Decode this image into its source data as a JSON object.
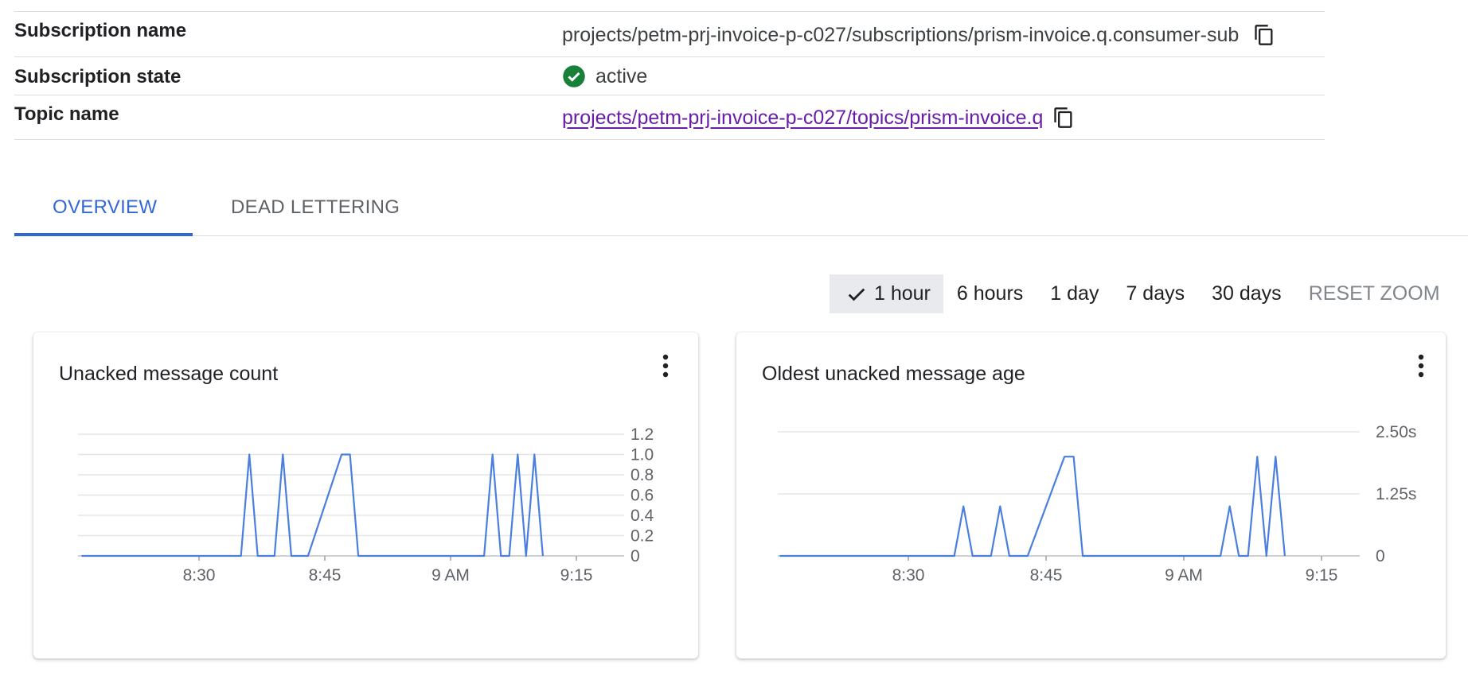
{
  "properties": {
    "subscription_name": {
      "label": "Subscription name",
      "value": "projects/petm-prj-invoice-p-c027/subscriptions/prism-invoice.q.consumer-sub"
    },
    "subscription_state": {
      "label": "Subscription state",
      "value": "active",
      "status_icon": "check-circle-icon",
      "status_color": "#188038"
    },
    "topic_name": {
      "label": "Topic name",
      "value": "projects/petm-prj-invoice-p-c027/topics/prism-invoice.q",
      "link_color": "#681da8"
    }
  },
  "tabs": [
    {
      "label": "OVERVIEW",
      "active": true
    },
    {
      "label": "DEAD LETTERING",
      "active": false
    }
  ],
  "time_range": {
    "options": [
      "1 hour",
      "6 hours",
      "1 day",
      "7 days",
      "30 days"
    ],
    "selected": "1 hour",
    "reset_label": "RESET ZOOM"
  },
  "accent_color": "#3367d6",
  "chart_data": [
    {
      "type": "line",
      "title": "Unacked message count",
      "series_color": "#4a7fe0",
      "x_tick_labels": [
        "8:30",
        "8:45",
        "9 AM",
        "9:15"
      ],
      "y_tick_labels": [
        "1.2",
        "1.0",
        "0.8",
        "0.6",
        "0.4",
        "0.2",
        "0"
      ],
      "ylim": [
        0,
        1.2
      ],
      "grid": true,
      "series": [
        {
          "x": [
            "8:16",
            "8:35",
            "8:36",
            "8:37",
            "8:39",
            "8:40",
            "8:41",
            "8:43",
            "8:47",
            "8:48",
            "8:49",
            "9:04",
            "9:05",
            "9:06",
            "9:07",
            "9:08",
            "9:09",
            "9:10",
            "9:11"
          ],
          "y": [
            0,
            0,
            1,
            0,
            0,
            1,
            0,
            0,
            1,
            1,
            0,
            0,
            1,
            0,
            0,
            1,
            0,
            1,
            0
          ]
        }
      ]
    },
    {
      "type": "line",
      "title": "Oldest unacked message age",
      "series_color": "#4a7fe0",
      "x_tick_labels": [
        "8:30",
        "8:45",
        "9 AM",
        "9:15"
      ],
      "y_tick_labels": [
        "2.50s",
        "1.25s",
        "0"
      ],
      "ylim": [
        0,
        2.5
      ],
      "grid": true,
      "series": [
        {
          "x": [
            "8:16",
            "8:35",
            "8:36",
            "8:37",
            "8:39",
            "8:40",
            "8:41",
            "8:43",
            "8:47",
            "8:48",
            "8:49",
            "9:04",
            "9:05",
            "9:06",
            "9:07",
            "9:08",
            "9:09",
            "9:10",
            "9:11"
          ],
          "y": [
            0,
            0,
            1,
            0,
            0,
            1,
            0,
            0,
            2,
            2,
            0,
            0,
            1,
            0,
            0,
            2,
            0,
            2,
            0
          ]
        }
      ]
    }
  ]
}
